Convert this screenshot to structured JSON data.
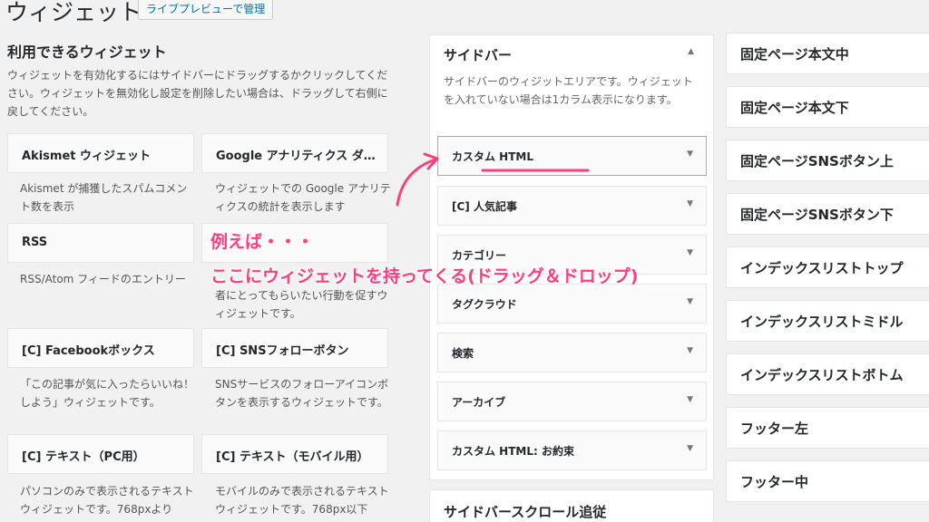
{
  "header": {
    "title": "ウィジェット",
    "manage_button": "ライブプレビューで管理"
  },
  "available": {
    "title": "利用できるウィジェット",
    "description": "ウィジェットを有効化するにはサイドバーにドラッグするかクリックしてください。ウィジェットを無効化し設定を削除したい場合は、ドラッグして右側に戻してください。",
    "widgets": [
      {
        "name": "Akismet ウィジェット",
        "desc": "Akismet が捕獲したスパムコメント数を表示"
      },
      {
        "name": "Google アナリティクス ダ…",
        "desc": "ウィジェットでの Google アナリティクスの統計を表示します"
      },
      {
        "name": "RSS",
        "desc": "RSS/Atom フィードのエントリー"
      },
      {
        "name": "",
        "desc": "者にとってもらいたい行動を促すウィジェットです。"
      },
      {
        "name": "[C] Facebookボックス",
        "desc": "「この記事が気に入ったらいいね！しよう」ウィジェットです。"
      },
      {
        "name": "[C] SNSフォローボタン",
        "desc": "SNSサービスのフォローアイコンボタンを表示するウィジェットです。"
      },
      {
        "name": "[C] テキスト（PC用）",
        "desc": "パソコンのみで表示されるテキストウィジェットです。768pxより"
      },
      {
        "name": "[C] テキスト（モバイル用）",
        "desc": "モバイルのみで表示されるテキストウィジェットです。768px以下"
      }
    ]
  },
  "sidebar": {
    "title": "サイドバー",
    "toggle": "▲",
    "description": "サイドバーのウィジットエリアです。ウィジェットを入れていない場合は1カラム表示になります。",
    "widgets": [
      {
        "name": "カスタム HTML"
      },
      {
        "name": "[C] 人気記事"
      },
      {
        "name": "カテゴリー"
      },
      {
        "name": "タグクラウド"
      },
      {
        "name": "検索"
      },
      {
        "name": "アーカイブ"
      },
      {
        "name": "カスタム HTML: お約束"
      }
    ],
    "arrow": "▼"
  },
  "scroll_sidebar": {
    "title": "サイドバースクロール追従"
  },
  "right_areas": [
    {
      "title": "固定ページ本文中"
    },
    {
      "title": "固定ページ本文下"
    },
    {
      "title": "固定ページSNSボタン上"
    },
    {
      "title": "固定ページSNSボタン下"
    },
    {
      "title": "インデックスリストトップ"
    },
    {
      "title": "インデックスリストミドル"
    },
    {
      "title": "インデックスリストボトム"
    },
    {
      "title": "フッター左"
    },
    {
      "title": "フッター中"
    }
  ],
  "annotation": {
    "line1": "例えば・・・",
    "line2": "ここにウィジェットを持ってくる(ドラッグ＆ドロップ)",
    "color": "#ff3d7f"
  }
}
